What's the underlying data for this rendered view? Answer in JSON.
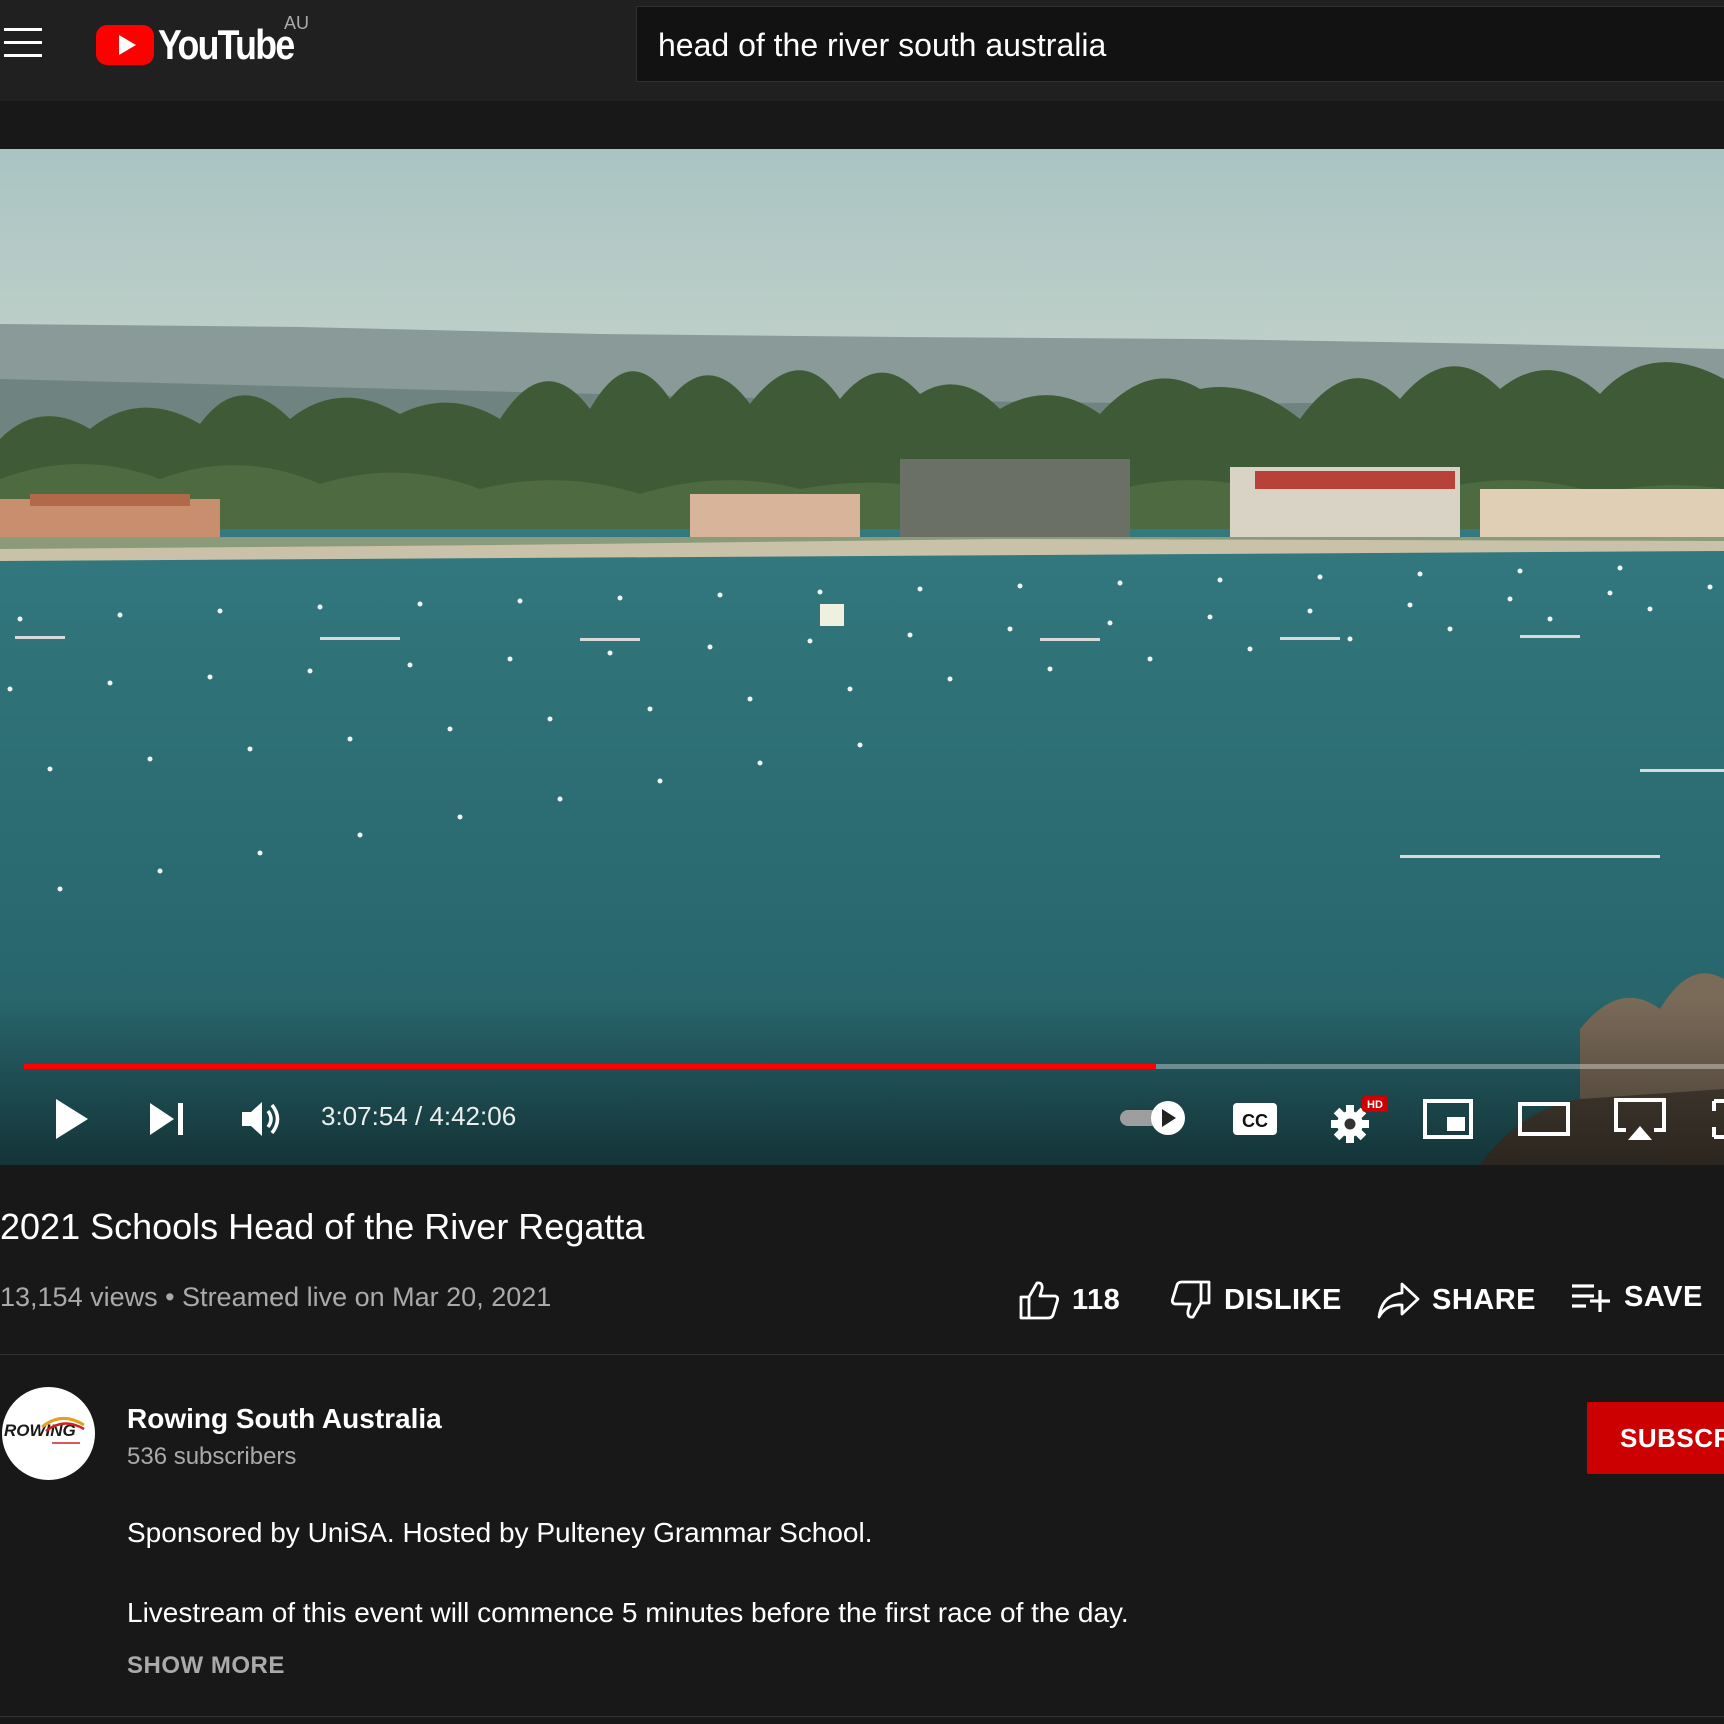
{
  "header": {
    "logo_text": "YouTube",
    "region": "AU",
    "search_value": "head of the river south australia"
  },
  "player": {
    "current_time": "3:07:54",
    "duration": "4:42:06",
    "timecode": "3:07:54 / 4:42:06",
    "progress_fraction": 0.6657,
    "settings_badge": "HD",
    "accent_color": "#ff0000"
  },
  "video": {
    "title": "2021 Schools Head of the River Regatta",
    "meta": "13,154 views • Streamed live on Mar 20, 2021",
    "likes": "118",
    "dislike_label": "DISLIKE",
    "share_label": "SHARE",
    "save_label": "SAVE"
  },
  "channel": {
    "name": "Rowing South Australia",
    "subscribers": "536 subscribers",
    "avatar_text": "ROWING",
    "subscribe_label": "SUBSCRIBE"
  },
  "description": {
    "line1": "Sponsored by UniSA. Hosted by Pulteney Grammar School.",
    "line2": "Livestream of this event will commence 5 minutes before the first race of the day.",
    "show_more": "SHOW MORE"
  },
  "icons": {
    "menu": "menu-icon",
    "play": "play-icon",
    "next": "next-icon",
    "volume": "volume-icon",
    "autoplay": "autoplay-toggle-icon",
    "captions": "cc-icon",
    "settings": "gear-icon",
    "miniplayer": "miniplayer-icon",
    "theater": "theater-icon",
    "cast": "cast-icon",
    "like": "thumbs-up-icon",
    "dislike": "thumbs-down-icon",
    "share": "share-icon",
    "save": "playlist-add-icon"
  }
}
